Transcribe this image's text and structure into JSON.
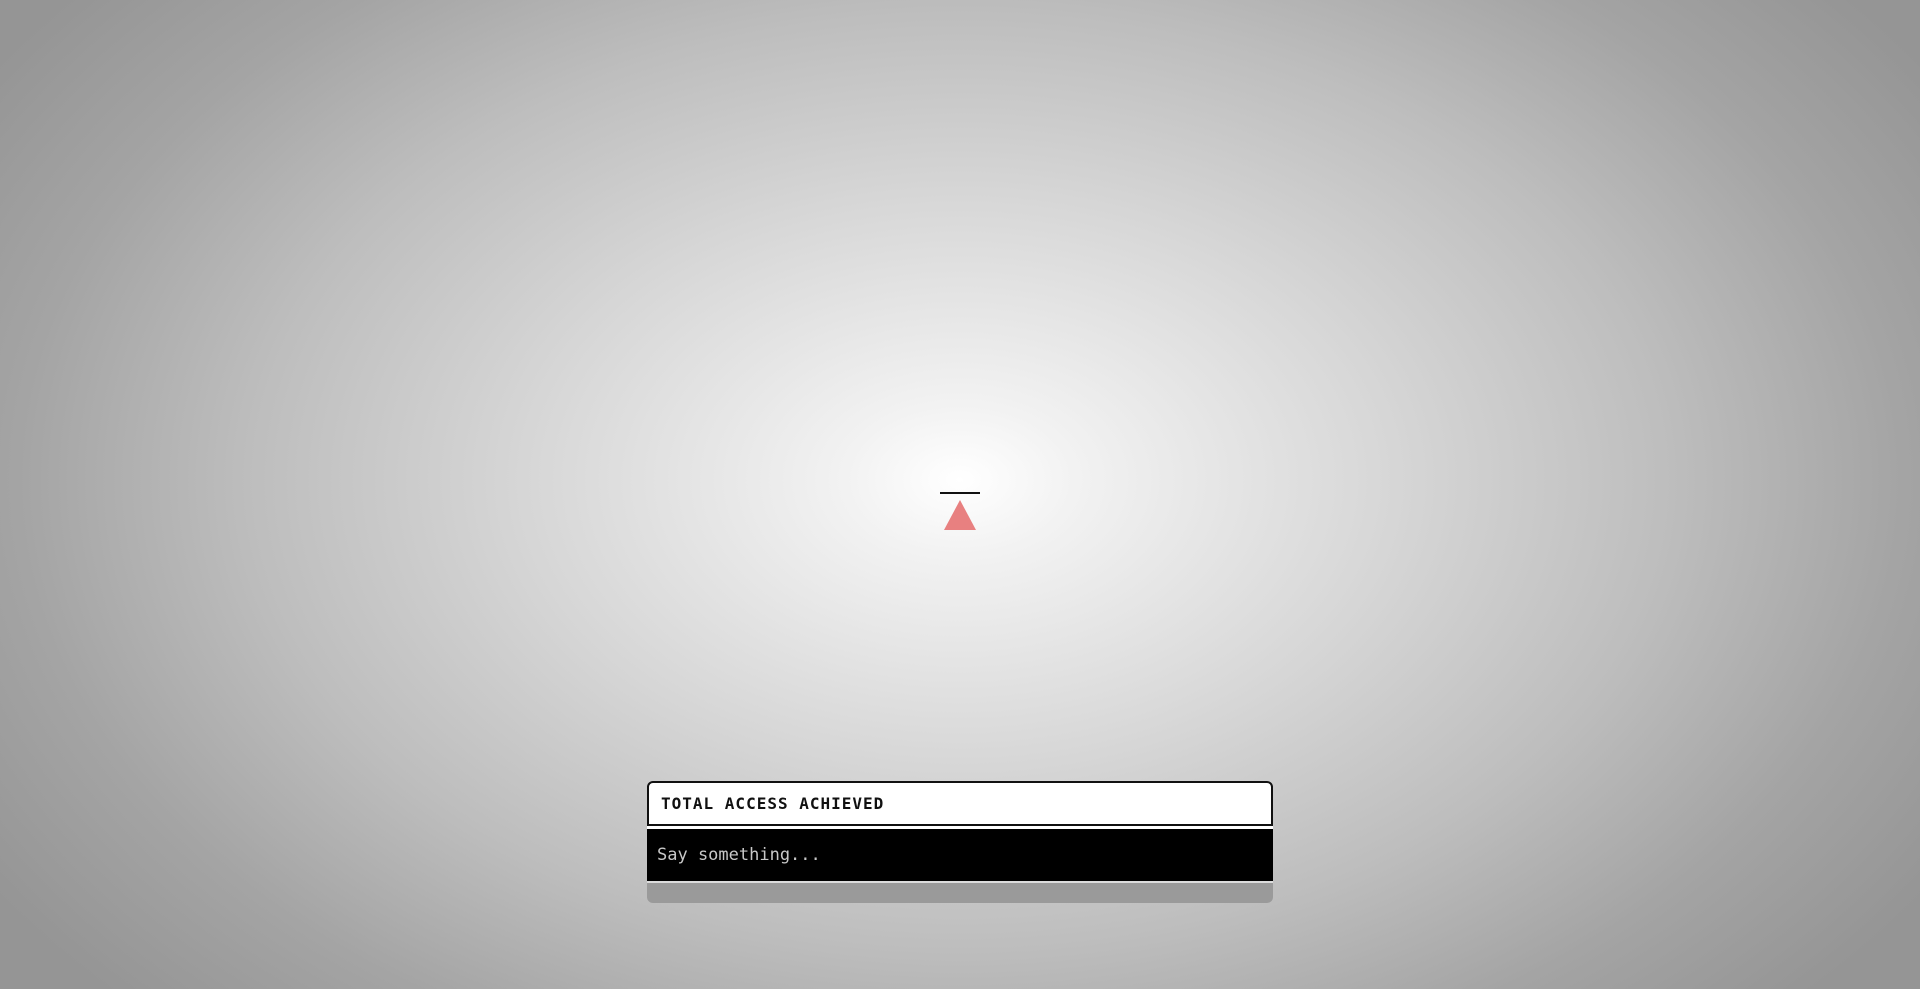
{
  "avatar": {
    "icon": "triangle-avatar-icon",
    "color": "#e88080",
    "line_color": "#111111"
  },
  "chat": {
    "title": "TOTAL ACCESS ACHIEVED",
    "input": {
      "placeholder": "Say something...",
      "value": ""
    }
  },
  "colors": {
    "background_center": "#ffffff",
    "background_edge": "#959595",
    "input_background": "#000000"
  }
}
